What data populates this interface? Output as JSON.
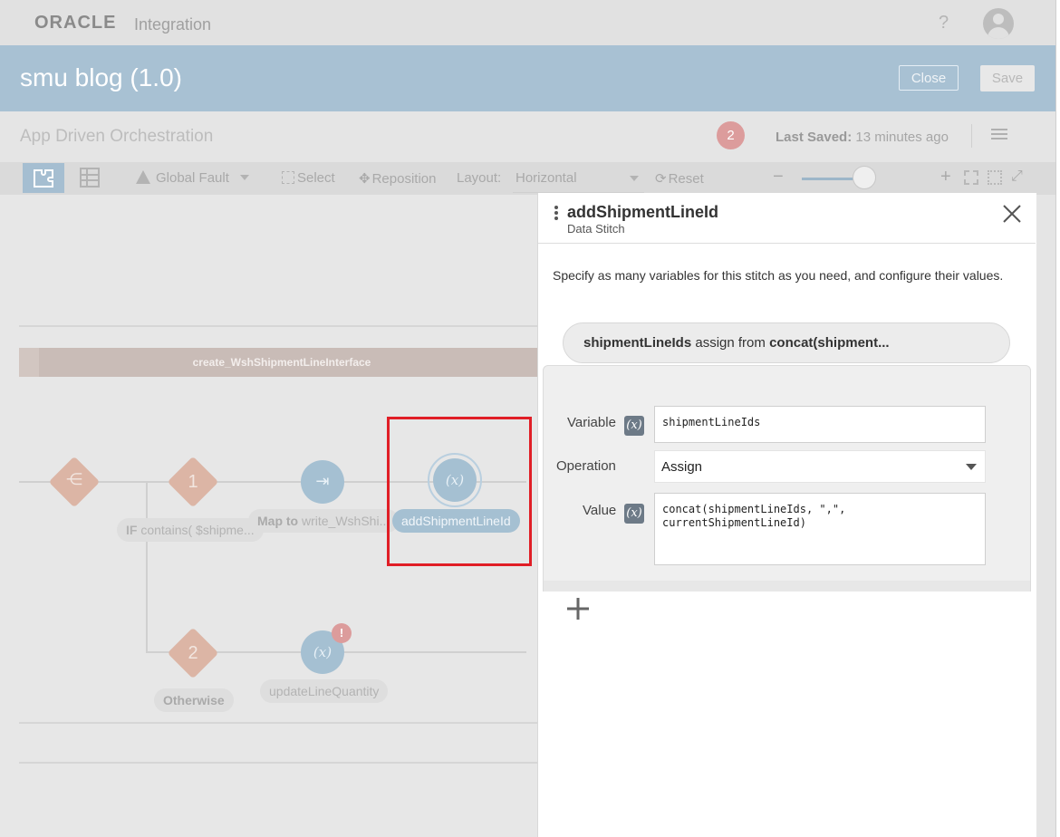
{
  "app": {
    "brand": "ORACLE",
    "product": "Integration",
    "help": "?"
  },
  "header": {
    "title": "smu blog (1.0)",
    "close_label": "Close",
    "save_label": "Save"
  },
  "subheader": {
    "pattern": "App Driven Orchestration",
    "error_count": "2",
    "last_saved_label": "Last Saved:",
    "last_saved_value": "13 minutes ago"
  },
  "toolbar": {
    "global_fault": "Global Fault",
    "select": "Select",
    "reposition": "Reposition",
    "layout_label": "Layout:",
    "layout_value": "Horizontal",
    "reset": "Reset",
    "zoom_level": 0.85
  },
  "canvas": {
    "scope_label": "create_WshShipmentLineInterface",
    "nodes": {
      "branch1_num": "1",
      "branch2_num": "2",
      "if_label_prefix": "IF",
      "if_label": "contains( $shipme...",
      "map_label_prefix": "Map to",
      "map_label": "write_WshShi...",
      "stitch1_label": "addShipmentLineId",
      "stitch2_label": "updateLineQuantity",
      "otherwise_label": "Otherwise",
      "stitch_symbol": "(x)",
      "warning_symbol": "!"
    }
  },
  "panel": {
    "title": "addShipmentLineId",
    "subtitle": "Data Stitch",
    "description": "Specify as many variables for this stitch as you need, and configure their values.",
    "summary": {
      "variable": "shipmentLineIds",
      "middle": "assign from",
      "expression": "concat(shipment..."
    },
    "variable_label": "Variable",
    "variable_value": "shipmentLineIds",
    "operation_label": "Operation",
    "operation_value": "Assign",
    "value_label": "Value",
    "value_value": "concat(shipmentLineIds, \",\", currentShipmentLineId)",
    "expr_symbol": "(x)"
  },
  "colors": {
    "accent": "#a8c1d3",
    "highlight": "#e01e26",
    "badge": "#dc9c9c"
  }
}
